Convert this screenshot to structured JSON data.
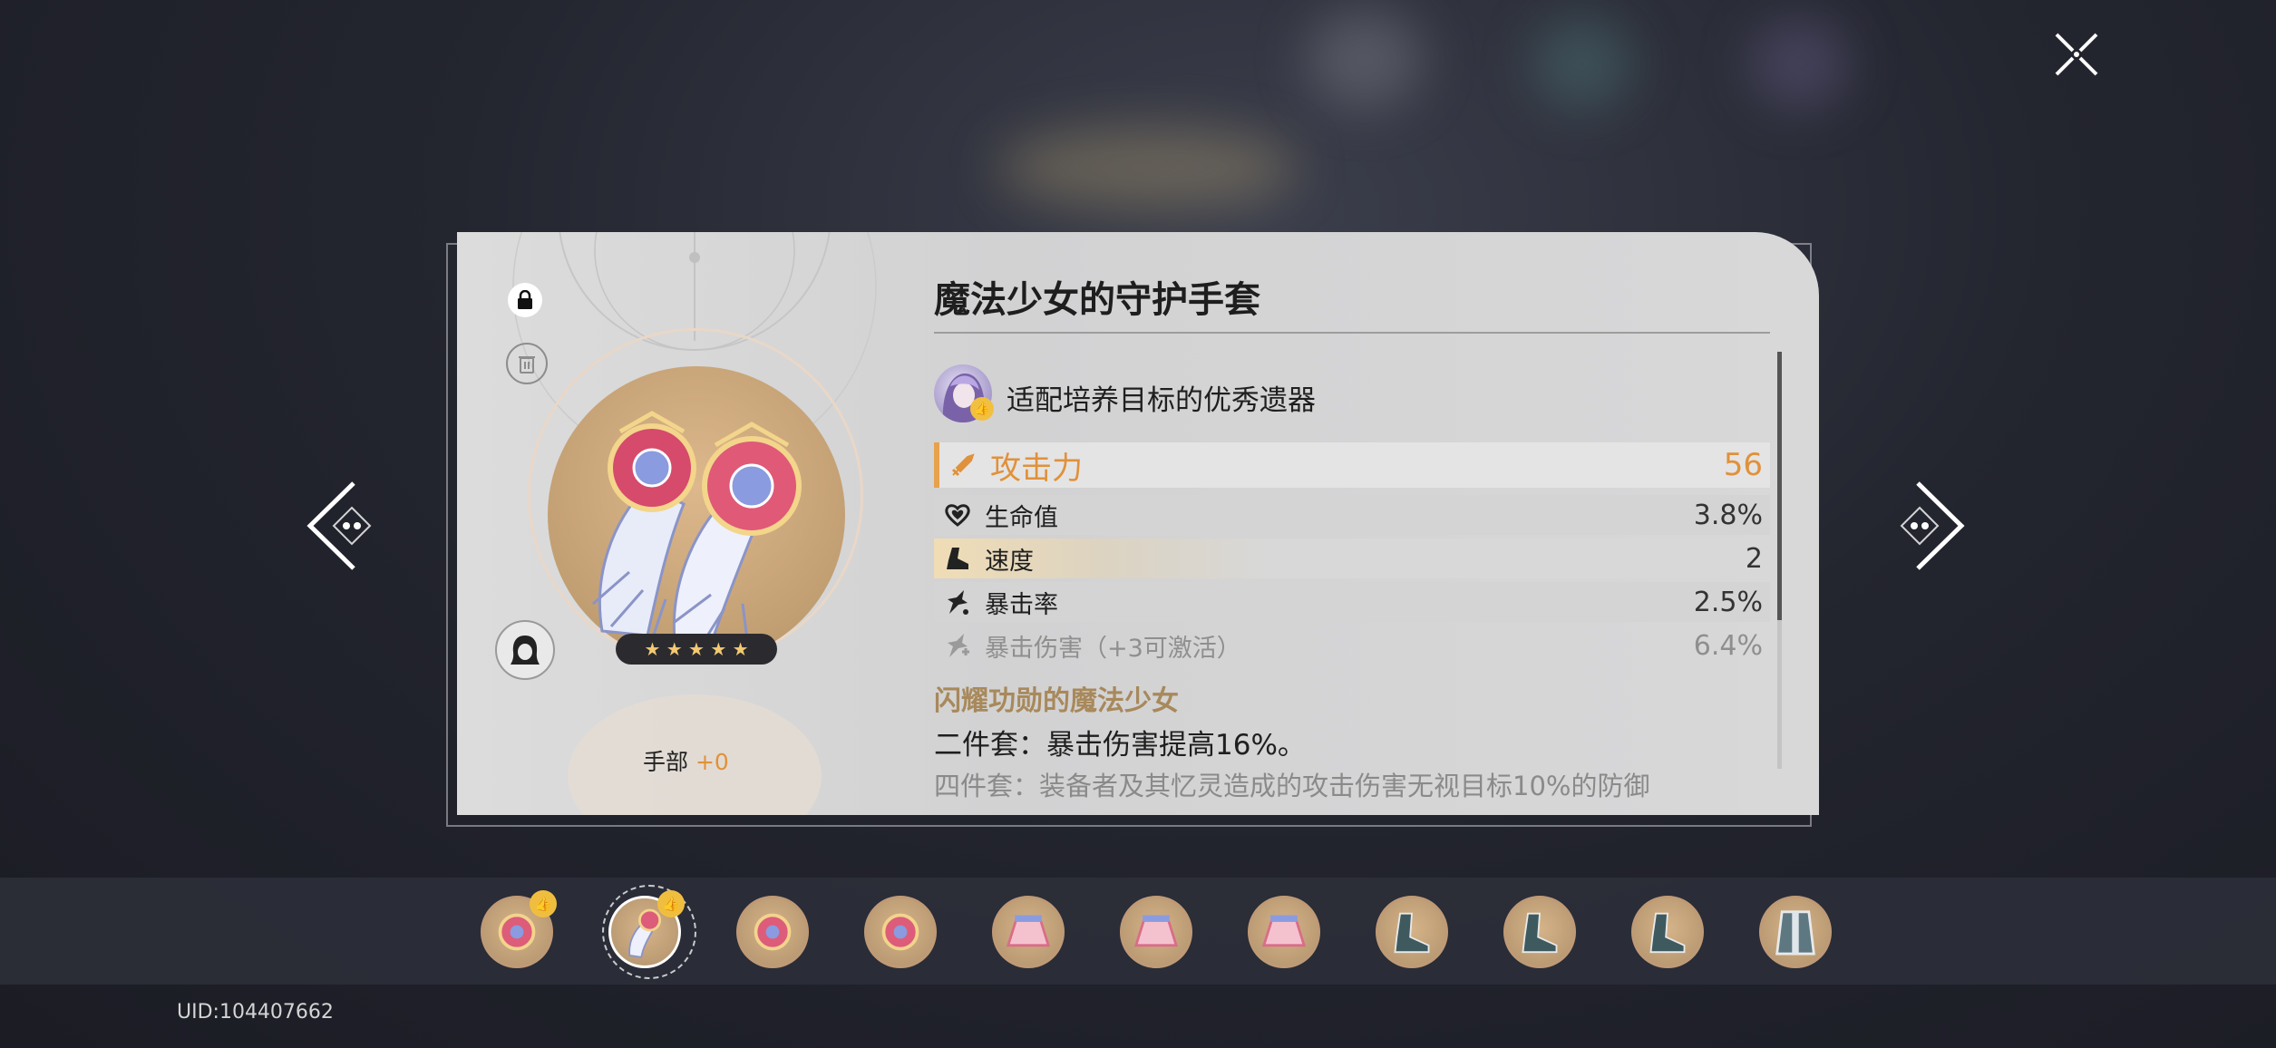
{
  "relic": {
    "name": "魔法少女的守护手套",
    "rarity_stars": 5,
    "star_glyphs": "★ ★ ★ ★ ★",
    "slot": "手部",
    "level": "+0",
    "recommendation": "适配培养目标的优秀遗器",
    "main_stat": {
      "icon": "attack-sword-icon",
      "name": "攻击力",
      "value": "56"
    },
    "sub_stats": [
      {
        "icon": "hp-heart-icon",
        "name": "生命值",
        "value": "3.8%"
      },
      {
        "icon": "speed-boot-icon",
        "name": "速度",
        "value": "2"
      },
      {
        "icon": "crit-rate-icon",
        "name": "暴击率",
        "value": "2.5%"
      },
      {
        "icon": "crit-dmg-icon",
        "name": "暴击伤害（+3可激活）",
        "value": "6.4%"
      }
    ],
    "set": {
      "name": "闪耀功勋的魔法少女",
      "two_piece": "二件套：暴击伤害提高16%。",
      "four_piece": "四件套：装备者及其忆灵造成的攻击伤害无视目标10%的防御"
    }
  },
  "colors": {
    "accent": "#e0913b",
    "set_name": "#a8895b",
    "badge": "#f0be3f"
  },
  "bottom": {
    "uid": "UID:104407662",
    "thumbnails": [
      {
        "icon": "relic-brooch-icon",
        "badge": true
      },
      {
        "icon": "relic-gloves-icon",
        "badge": true,
        "selected": true
      },
      {
        "icon": "relic-brooch-icon"
      },
      {
        "icon": "relic-brooch-icon"
      },
      {
        "icon": "relic-skirt-icon"
      },
      {
        "icon": "relic-skirt-icon"
      },
      {
        "icon": "relic-skirt-icon"
      },
      {
        "icon": "relic-boots-icon"
      },
      {
        "icon": "relic-boots-icon"
      },
      {
        "icon": "relic-boots-icon"
      },
      {
        "icon": "relic-cloak-icon"
      }
    ]
  }
}
